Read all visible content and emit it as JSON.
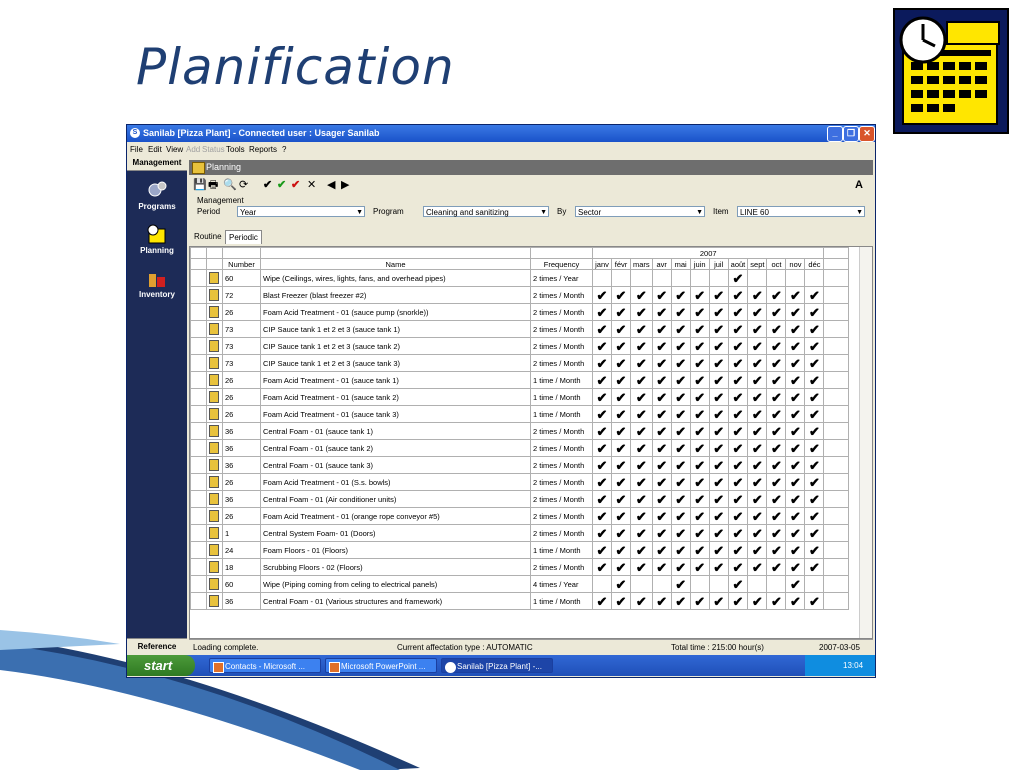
{
  "slide": {
    "title": "Planification"
  },
  "window": {
    "title": "Sanilab [Pizza Plant] - Connected user : Usager Sanilab",
    "menu": [
      "File",
      "Edit",
      "View",
      "Add",
      "Status",
      "Tools",
      "Reports",
      "?"
    ],
    "menu_disabled": [
      "Add",
      "Status"
    ]
  },
  "sidebar": {
    "tab": "Management",
    "items": [
      {
        "label": "Programs",
        "icon": "programs-icon"
      },
      {
        "label": "Planning",
        "icon": "planning-icon"
      },
      {
        "label": "Inventory",
        "icon": "inventory-icon"
      }
    ],
    "reference": "Reference"
  },
  "panel": {
    "title": "Planning",
    "right_letter": "A"
  },
  "management": {
    "group_label": "Management",
    "period_label": "Period",
    "period_value": "Year",
    "program_label": "Program",
    "program_value": "Cleaning and sanitizing",
    "by_label": "By",
    "by_value": "Sector",
    "item_label": "Item",
    "item_value": "LINE 60"
  },
  "tabs": [
    {
      "label": "Routine"
    },
    {
      "label": "Periodic"
    }
  ],
  "grid": {
    "year": "2007",
    "headers": {
      "number": "Number",
      "name": "Name",
      "frequency": "Frequency"
    },
    "months": [
      "janv",
      "févr",
      "mars",
      "avr",
      "mai",
      "juin",
      "juil",
      "août",
      "sept",
      "oct",
      "nov",
      "déc"
    ],
    "check_glyph": "✔",
    "rows": [
      {
        "number": "60",
        "name": "Wipe (Ceilings, wires, lights, fans, and overhead pipes)",
        "frequency": "2 times / Year",
        "checks": [
          0,
          0,
          0,
          0,
          0,
          0,
          0,
          1,
          0,
          0,
          0,
          0
        ]
      },
      {
        "number": "72",
        "name": "Blast Freezer (blast freezer #2)",
        "frequency": "2 times / Month",
        "checks": [
          1,
          1,
          1,
          1,
          1,
          1,
          1,
          1,
          1,
          1,
          1,
          1
        ]
      },
      {
        "number": "26",
        "name": "Foam Acid Treatment - 01 (sauce pump (snorkle))",
        "frequency": "2 times / Month",
        "checks": [
          1,
          1,
          1,
          1,
          1,
          1,
          1,
          1,
          1,
          1,
          1,
          1
        ]
      },
      {
        "number": "73",
        "name": "CIP Sauce tank 1 et 2 et 3 (sauce tank 1)",
        "frequency": "2 times / Month",
        "checks": [
          1,
          1,
          1,
          1,
          1,
          1,
          1,
          1,
          1,
          1,
          1,
          1
        ]
      },
      {
        "number": "73",
        "name": "CIP Sauce tank 1 et 2 et 3 (sauce tank 2)",
        "frequency": "2 times / Month",
        "checks": [
          1,
          1,
          1,
          1,
          1,
          1,
          1,
          1,
          1,
          1,
          1,
          1
        ]
      },
      {
        "number": "73",
        "name": "CIP Sauce tank 1 et 2 et 3 (sauce tank 3)",
        "frequency": "2 times / Month",
        "checks": [
          1,
          1,
          1,
          1,
          1,
          1,
          1,
          1,
          1,
          1,
          1,
          1
        ]
      },
      {
        "number": "26",
        "name": "Foam Acid Treatment - 01 (sauce tank 1)",
        "frequency": "1 time / Month",
        "checks": [
          1,
          1,
          1,
          1,
          1,
          1,
          1,
          1,
          1,
          1,
          1,
          1
        ]
      },
      {
        "number": "26",
        "name": "Foam Acid Treatment - 01 (sauce tank 2)",
        "frequency": "1 time / Month",
        "checks": [
          1,
          1,
          1,
          1,
          1,
          1,
          1,
          1,
          1,
          1,
          1,
          1
        ]
      },
      {
        "number": "26",
        "name": "Foam Acid Treatment - 01 (sauce tank 3)",
        "frequency": "1 time / Month",
        "checks": [
          1,
          1,
          1,
          1,
          1,
          1,
          1,
          1,
          1,
          1,
          1,
          1
        ]
      },
      {
        "number": "36",
        "name": "Central Foam - 01 (sauce tank 1)",
        "frequency": "2 times / Month",
        "checks": [
          1,
          1,
          1,
          1,
          1,
          1,
          1,
          1,
          1,
          1,
          1,
          1
        ]
      },
      {
        "number": "36",
        "name": "Central Foam - 01 (sauce tank 2)",
        "frequency": "2 times / Month",
        "checks": [
          1,
          1,
          1,
          1,
          1,
          1,
          1,
          1,
          1,
          1,
          1,
          1
        ]
      },
      {
        "number": "36",
        "name": "Central Foam - 01 (sauce tank 3)",
        "frequency": "2 times / Month",
        "checks": [
          1,
          1,
          1,
          1,
          1,
          1,
          1,
          1,
          1,
          1,
          1,
          1
        ]
      },
      {
        "number": "26",
        "name": "Foam Acid Treatment - 01 (S.s. bowls)",
        "frequency": "2 times / Month",
        "checks": [
          1,
          1,
          1,
          1,
          1,
          1,
          1,
          1,
          1,
          1,
          1,
          1
        ]
      },
      {
        "number": "36",
        "name": "Central Foam - 01 (Air conditioner units)",
        "frequency": "2 times / Month",
        "checks": [
          1,
          1,
          1,
          1,
          1,
          1,
          1,
          1,
          1,
          1,
          1,
          1
        ]
      },
      {
        "number": "26",
        "name": "Foam Acid Treatment - 01 (orange rope conveyor #5)",
        "frequency": "2 times / Month",
        "checks": [
          1,
          1,
          1,
          1,
          1,
          1,
          1,
          1,
          1,
          1,
          1,
          1
        ]
      },
      {
        "number": "1",
        "name": "Central System Foam- 01 (Doors)",
        "frequency": "2 times / Month",
        "checks": [
          1,
          1,
          1,
          1,
          1,
          1,
          1,
          1,
          1,
          1,
          1,
          1
        ]
      },
      {
        "number": "24",
        "name": "Foam Floors - 01 (Floors)",
        "frequency": "1 time / Month",
        "checks": [
          1,
          1,
          1,
          1,
          1,
          1,
          1,
          1,
          1,
          1,
          1,
          1
        ]
      },
      {
        "number": "18",
        "name": "Scrubbing Floors - 02 (Floors)",
        "frequency": "2 times / Month",
        "checks": [
          1,
          1,
          1,
          1,
          1,
          1,
          1,
          1,
          1,
          1,
          1,
          1
        ]
      },
      {
        "number": "60",
        "name": "Wipe (Piping coming from celing to electrical panels)",
        "frequency": "4 times / Year",
        "checks": [
          0,
          1,
          0,
          0,
          1,
          0,
          0,
          1,
          0,
          0,
          1,
          0
        ]
      },
      {
        "number": "36",
        "name": "Central Foam - 01 (Various structures and framework)",
        "frequency": "1 time / Month",
        "checks": [
          1,
          1,
          1,
          1,
          1,
          1,
          1,
          1,
          1,
          1,
          1,
          1
        ]
      }
    ]
  },
  "status": {
    "left": "Loading complete.",
    "mid": "Current affectation type : AUTOMATIC",
    "total": "Total time : 215:00 hour(s)",
    "date": "2007-03-05"
  },
  "taskbar": {
    "start": "start",
    "tasks": [
      "Contacts - Microsoft ...",
      "Microsoft PowerPoint ...",
      "Sanilab [Pizza Plant] -..."
    ],
    "clock": "13:04"
  }
}
